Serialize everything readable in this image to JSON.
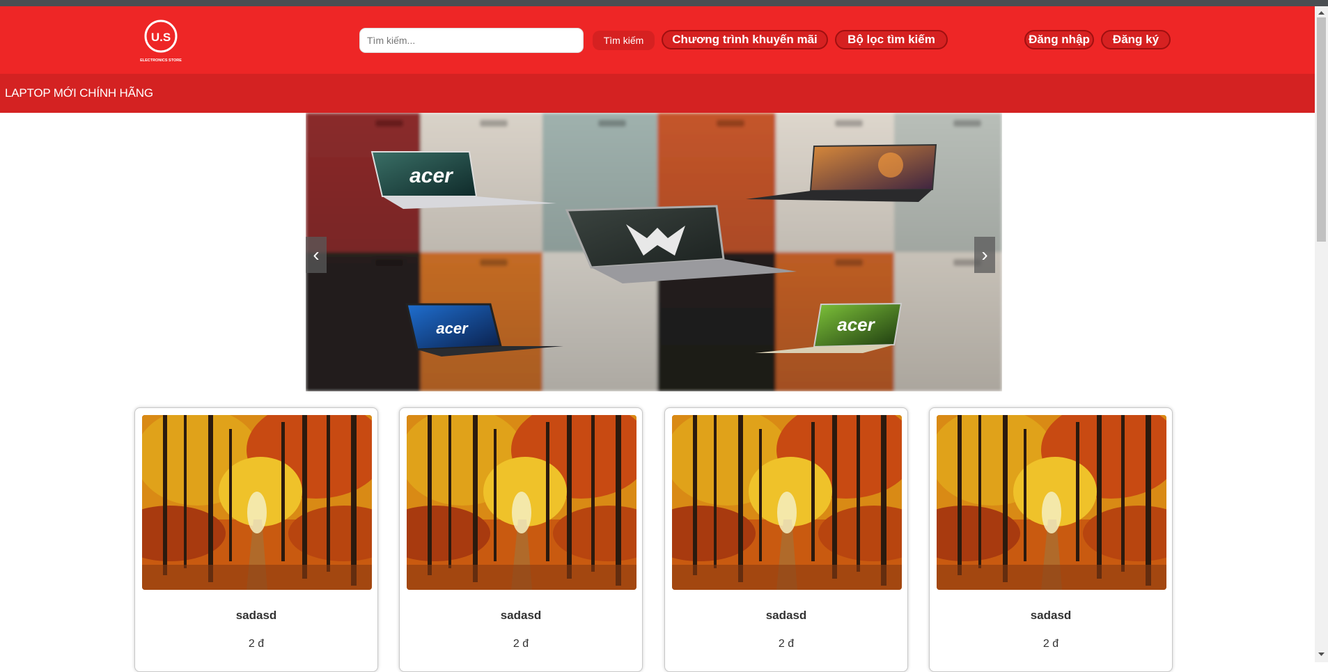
{
  "header": {
    "logo_text": "U.S",
    "logo_subtext": "ELECTRONICS STORE",
    "search_placeholder": "Tìm kiếm...",
    "search_button": "Tìm kiếm",
    "nav": {
      "promotions": "Chương trình khuyến mãi",
      "filter": "Bộ lọc tìm kiếm",
      "login": "Đăng nhập",
      "register": "Đăng ký"
    }
  },
  "subbar": {
    "title": "LAPTOP MỚI CHÍNH HÃNG"
  },
  "carousel": {
    "prev_glyph": "‹",
    "next_glyph": "›",
    "brand_texts": [
      "acer",
      "acer",
      "acer"
    ]
  },
  "products": [
    {
      "name": "sadasd",
      "price": "2 đ"
    },
    {
      "name": "sadasd",
      "price": "2 đ"
    },
    {
      "name": "sadasd",
      "price": "2 đ"
    },
    {
      "name": "sadasd",
      "price": "2 đ"
    }
  ],
  "colors": {
    "header_red": "#ee2626",
    "subbar_red": "#d42222",
    "button_red": "#d62121"
  }
}
